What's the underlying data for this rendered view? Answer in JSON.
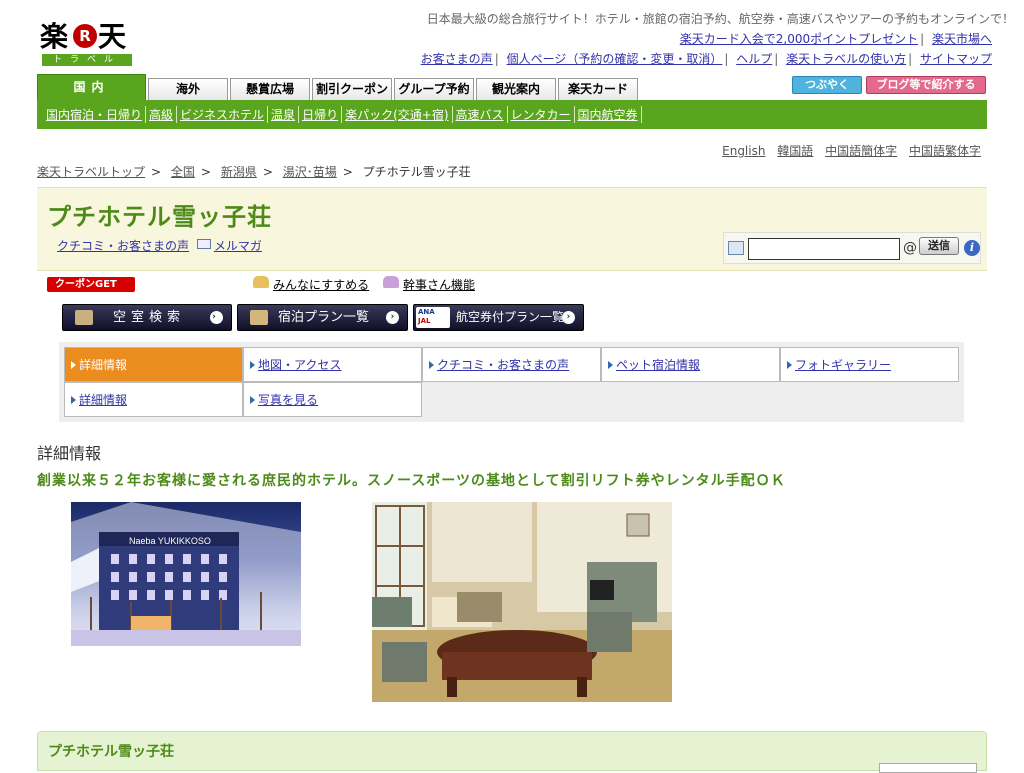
{
  "logo": {
    "k1": "楽",
    "r": "R",
    "k2": "天",
    "sub": "トラベル"
  },
  "tagline": "日本最大級の総合旅行サイト！ホテル・旅館の宿泊予約、航空券・高速バスやツアーの予約もオンラインで！",
  "toplinks_row1": [
    "楽天カード入会で2,000ポイントプレゼント",
    "楽天市場へ"
  ],
  "toplinks_row2": [
    "お客さまの声",
    "個人ページ（予約の確認・変更・取消）",
    "ヘルプ",
    "楽天トラベルの使い方",
    "サイトマップ"
  ],
  "tabs": [
    "国内",
    "海外",
    "懸賞広場",
    "割引クーポン",
    "グループ予約",
    "観光案内",
    "楽天カード"
  ],
  "sns": {
    "tweet": "つぶやく",
    "blog": "ブログ等で紹介する"
  },
  "subnav": [
    "国内宿泊・日帰り",
    "高級",
    "ビジネスホテル",
    "温泉",
    "日帰り",
    "楽パック(交通+宿)",
    "高速バス",
    "レンタカー",
    "国内航空券"
  ],
  "languages": [
    "English",
    "韓国語",
    "中国語簡体字",
    "中国語繁体字"
  ],
  "breadcrumb": {
    "items": [
      "楽天トラベルトップ",
      "全国",
      "新潟県",
      "湯沢･苗場"
    ],
    "current": "プチホテル雪ッ子荘",
    "sep": ">"
  },
  "hotel": {
    "name": "プチホテル雪ッ子荘",
    "link_reviews": "クチコミ・お客さまの声",
    "link_mailmag": "メルマガ",
    "email_placeholder": "",
    "at": "@",
    "send": "送信",
    "help": "i"
  },
  "coupon": "クーポンGET",
  "recommend": {
    "share": "みんなにすすめる",
    "organizer": "幹事さん機能"
  },
  "buttons": {
    "vacancy": "空室検索",
    "plans": "宿泊プラン一覧",
    "air_plans": "航空券付プラン一覧",
    "anajal_top": "ANA",
    "anajal_bottom": "JAL",
    "arrow": "›"
  },
  "info_tabs": {
    "row1": [
      "詳細情報",
      "地図・アクセス",
      "クチコミ・お客さまの声",
      "ペット宿泊情報",
      "フォトギャラリー"
    ],
    "row2": [
      "詳細情報",
      "写真を見る"
    ]
  },
  "section_title": "詳細情報",
  "catchphrase": "創業以来５２年お客様に愛される庶民的ホテル。スノースポーツの基地として割引リフト券やレンタル手配ＯＫ",
  "photo1_sign": "Naeba YUKIKKOSO",
  "bottom": {
    "title": "プチホテル雪ッ子荘"
  },
  "colors": {
    "brand_green": "#5aa51e",
    "title_green": "#4e8a1a",
    "active_orange": "#ea8c1e",
    "rakuten_red": "#bf0000"
  }
}
